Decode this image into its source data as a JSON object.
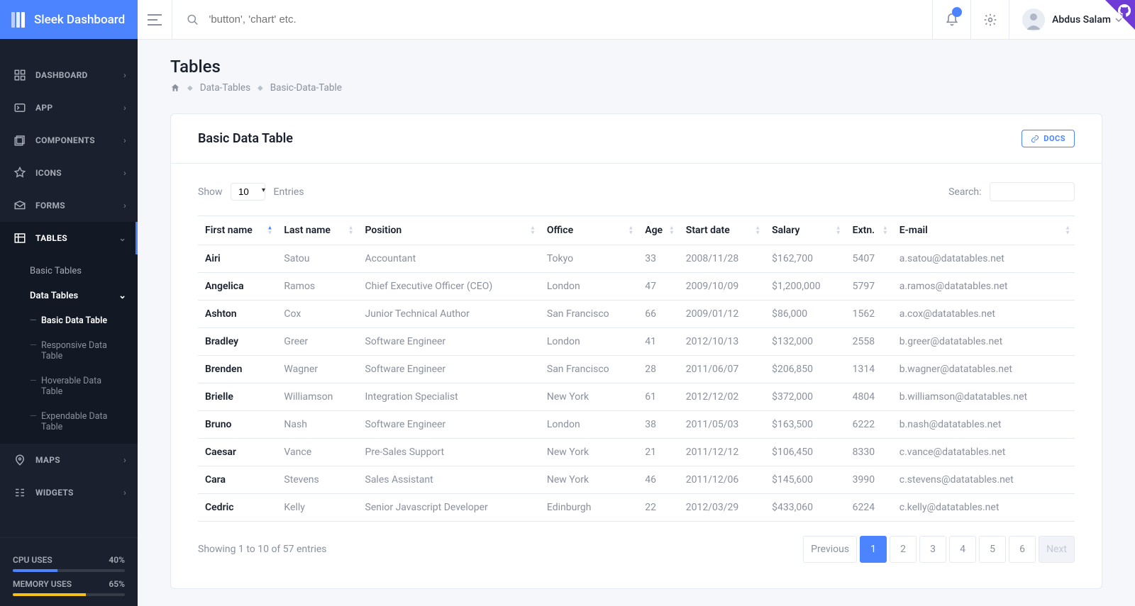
{
  "brand": "Sleek Dashboard",
  "header": {
    "search_placeholder": "'button', 'chart' etc.",
    "username": "Abdus Salam"
  },
  "sidebar": {
    "items": [
      {
        "label": "DASHBOARD",
        "expandable": true
      },
      {
        "label": "APP",
        "expandable": true
      },
      {
        "label": "COMPONENTS",
        "expandable": true
      },
      {
        "label": "ICONS",
        "expandable": true
      },
      {
        "label": "FORMS",
        "expandable": true
      },
      {
        "label": "TABLES",
        "expandable": true,
        "active": true
      },
      {
        "label": "MAPS",
        "expandable": true
      },
      {
        "label": "WIDGETS",
        "expandable": true
      }
    ],
    "tables_sub": [
      {
        "label": "Basic Tables",
        "active": false
      },
      {
        "label": "Data Tables",
        "active": true
      }
    ],
    "data_tables_sub": [
      {
        "label": "Basic Data Table",
        "active": true
      },
      {
        "label": "Responsive Data Table",
        "active": false
      },
      {
        "label": "Hoverable Data Table",
        "active": false
      },
      {
        "label": "Expendable Data Table",
        "active": false
      }
    ]
  },
  "stats": {
    "cpu_label": "CPU USES",
    "cpu_value": "40%",
    "cpu_pct": 40,
    "mem_label": "MEMORY USES",
    "mem_value": "65%",
    "mem_pct": 65
  },
  "page": {
    "title": "Tables",
    "crumbs": [
      "Data-Tables",
      "Basic-Data-Table"
    ]
  },
  "card": {
    "title": "Basic Data Table",
    "docs": "DOCS",
    "show_label": "Show",
    "entries_label": "Entries",
    "length_value": "10",
    "search_label": "Search:",
    "info": "Showing 1 to 10 of 57 entries"
  },
  "columns": [
    "First name",
    "Last name",
    "Position",
    "Office",
    "Age",
    "Start date",
    "Salary",
    "Extn.",
    "E-mail"
  ],
  "rows": [
    [
      "Airi",
      "Satou",
      "Accountant",
      "Tokyo",
      "33",
      "2008/11/28",
      "$162,700",
      "5407",
      "a.satou@datatables.net"
    ],
    [
      "Angelica",
      "Ramos",
      "Chief Executive Officer (CEO)",
      "London",
      "47",
      "2009/10/09",
      "$1,200,000",
      "5797",
      "a.ramos@datatables.net"
    ],
    [
      "Ashton",
      "Cox",
      "Junior Technical Author",
      "San Francisco",
      "66",
      "2009/01/12",
      "$86,000",
      "1562",
      "a.cox@datatables.net"
    ],
    [
      "Bradley",
      "Greer",
      "Software Engineer",
      "London",
      "41",
      "2012/10/13",
      "$132,000",
      "2558",
      "b.greer@datatables.net"
    ],
    [
      "Brenden",
      "Wagner",
      "Software Engineer",
      "San Francisco",
      "28",
      "2011/06/07",
      "$206,850",
      "1314",
      "b.wagner@datatables.net"
    ],
    [
      "Brielle",
      "Williamson",
      "Integration Specialist",
      "New York",
      "61",
      "2012/12/02",
      "$372,000",
      "4804",
      "b.williamson@datatables.net"
    ],
    [
      "Bruno",
      "Nash",
      "Software Engineer",
      "London",
      "38",
      "2011/05/03",
      "$163,500",
      "6222",
      "b.nash@datatables.net"
    ],
    [
      "Caesar",
      "Vance",
      "Pre-Sales Support",
      "New York",
      "21",
      "2011/12/12",
      "$106,450",
      "8330",
      "c.vance@datatables.net"
    ],
    [
      "Cara",
      "Stevens",
      "Sales Assistant",
      "New York",
      "46",
      "2011/12/06",
      "$145,600",
      "3990",
      "c.stevens@datatables.net"
    ],
    [
      "Cedric",
      "Kelly",
      "Senior Javascript Developer",
      "Edinburgh",
      "22",
      "2012/03/29",
      "$433,060",
      "6224",
      "c.kelly@datatables.net"
    ]
  ],
  "pagination": {
    "prev": "Previous",
    "next": "Next",
    "pages": [
      "1",
      "2",
      "3",
      "4",
      "5",
      "6"
    ],
    "active": 0
  }
}
